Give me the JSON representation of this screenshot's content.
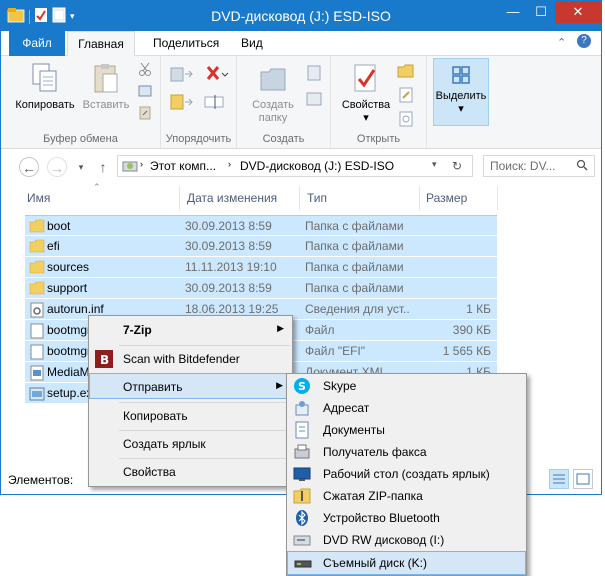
{
  "window": {
    "title": "DVD-дисковод (J:) ESD-ISO"
  },
  "tabs": {
    "file": "Файл",
    "home": "Главная",
    "share": "Поделиться",
    "view": "Вид"
  },
  "ribbon": {
    "copy": "Копировать",
    "paste": "Вставить",
    "clipboard_group": "Буфер обмена",
    "organize_group": "Упорядочить",
    "new_folder": "Создать папку",
    "create_group": "Создать",
    "properties": "Свойства",
    "open_group": "Открыть",
    "select": "Выделить"
  },
  "address": {
    "crumb1": "Этот комп...",
    "crumb2": "DVD-дисковод (J:) ESD-ISO",
    "search_placeholder": "Поиск: DV..."
  },
  "columns": {
    "name": "Имя",
    "date": "Дата изменения",
    "type": "Тип",
    "size": "Размер"
  },
  "files": [
    {
      "name": "boot",
      "date": "30.09.2013 8:59",
      "type": "Папка с файлами",
      "size": "",
      "icon": "folder"
    },
    {
      "name": "efi",
      "date": "30.09.2013 8:59",
      "type": "Папка с файлами",
      "size": "",
      "icon": "folder"
    },
    {
      "name": "sources",
      "date": "11.11.2013 19:10",
      "type": "Папка с файлами",
      "size": "",
      "icon": "folder"
    },
    {
      "name": "support",
      "date": "30.09.2013 8:59",
      "type": "Папка с файлами",
      "size": "",
      "icon": "folder"
    },
    {
      "name": "autorun.inf",
      "date": "18.06.2013 19:25",
      "type": "Сведения для уст...",
      "size": "1 КБ",
      "icon": "inf"
    },
    {
      "name": "bootmgr",
      "date": "",
      "type": "Файл",
      "size": "390 КБ",
      "icon": "file"
    },
    {
      "name": "bootmgr",
      "date": "",
      "type": "Файл \"EFI\"",
      "size": "1 565 КБ",
      "icon": "file"
    },
    {
      "name": "MediaMeta",
      "date": "",
      "type": "Документ XML",
      "size": "1 КБ",
      "icon": "xml"
    },
    {
      "name": "setup.exe",
      "date": "",
      "type": "",
      "size": "",
      "icon": "exe"
    }
  ],
  "status": {
    "items_label": "Элементов:"
  },
  "context_menu": {
    "zip": "7-Zip",
    "bitdefender": "Scan with Bitdefender",
    "send_to": "Отправить",
    "copy": "Копировать",
    "shortcut": "Создать ярлык",
    "properties": "Свойства"
  },
  "sendto_menu": {
    "skype": "Skype",
    "addressee": "Адресат",
    "documents": "Документы",
    "fax": "Получатель факса",
    "desktop": "Рабочий стол (создать ярлык)",
    "zip": "Сжатая ZIP-папка",
    "bluetooth": "Устройство Bluetooth",
    "dvd": "DVD RW дисковод (I:)",
    "removable": "Съемный диск (K:)"
  },
  "colors": {
    "accent": "#1979ca",
    "selection": "#cce8ff",
    "menu_highlight": "#d5e6f7"
  }
}
